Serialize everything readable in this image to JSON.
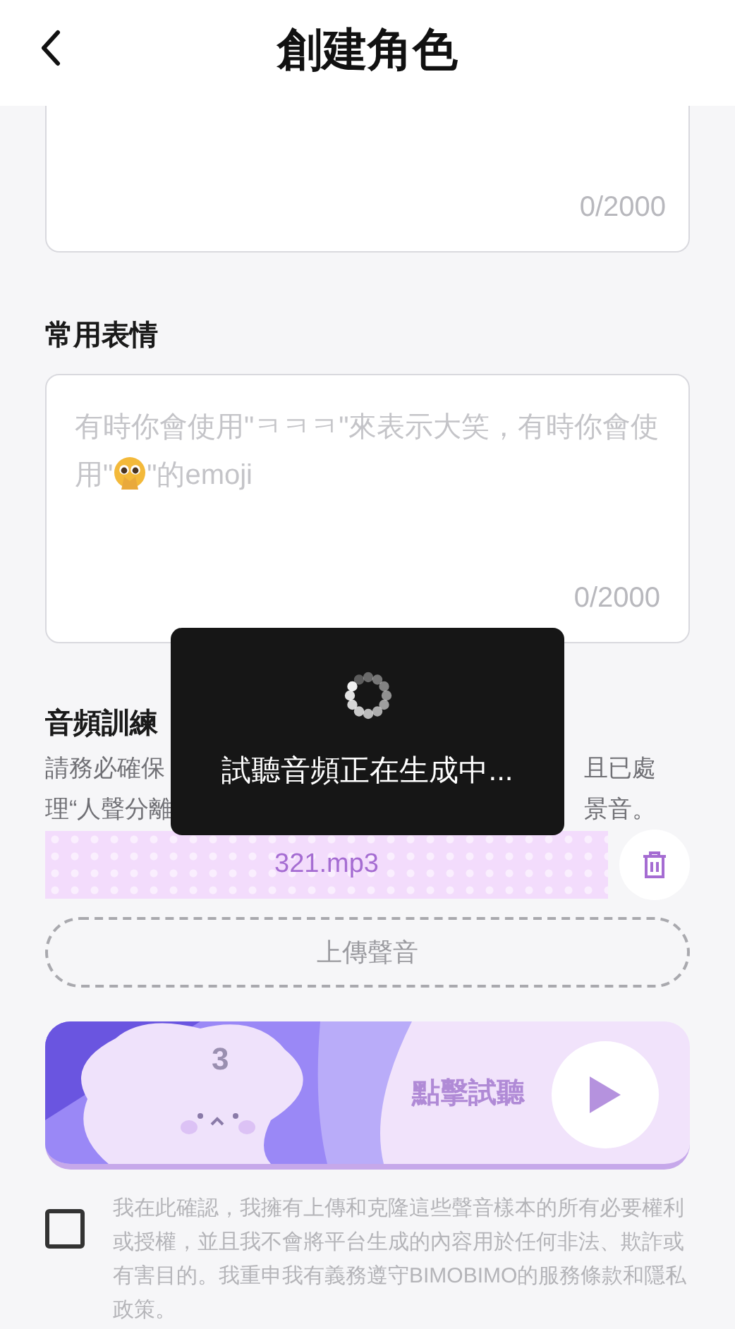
{
  "header": {
    "title": "創建角色"
  },
  "top_field": {
    "counter": "0/2000"
  },
  "expressions": {
    "label": "常用表情",
    "placeholder_before": "有時你會使用\"ㅋㅋㅋ\"來表示大笑，有時你會使用\"",
    "placeholder_after": "\"的emoji",
    "counter": "0/2000"
  },
  "audio": {
    "label": "音頻訓練",
    "description_lines": [
      {
        "left": "請務必確保",
        "right": "且已處"
      },
      {
        "left": "理“人聲分離",
        "right": "景音。"
      }
    ],
    "files": [
      {
        "name": "321.mp3"
      }
    ],
    "upload": "上傳聲音"
  },
  "preview": {
    "number": "3",
    "label": "點擊試聽"
  },
  "consent": {
    "checked": false,
    "text": "我在此確認，我擁有上傳和克隆這些聲音樣本的所有必要權利或授權，並且我不會將平台生成的內容用於任何非法、欺詐或有害目的。我重申我有義務遵守BIMOBIMO的服務條款和隱私政策。"
  },
  "toast": {
    "text": "試聽音頻正在生成中..."
  }
}
